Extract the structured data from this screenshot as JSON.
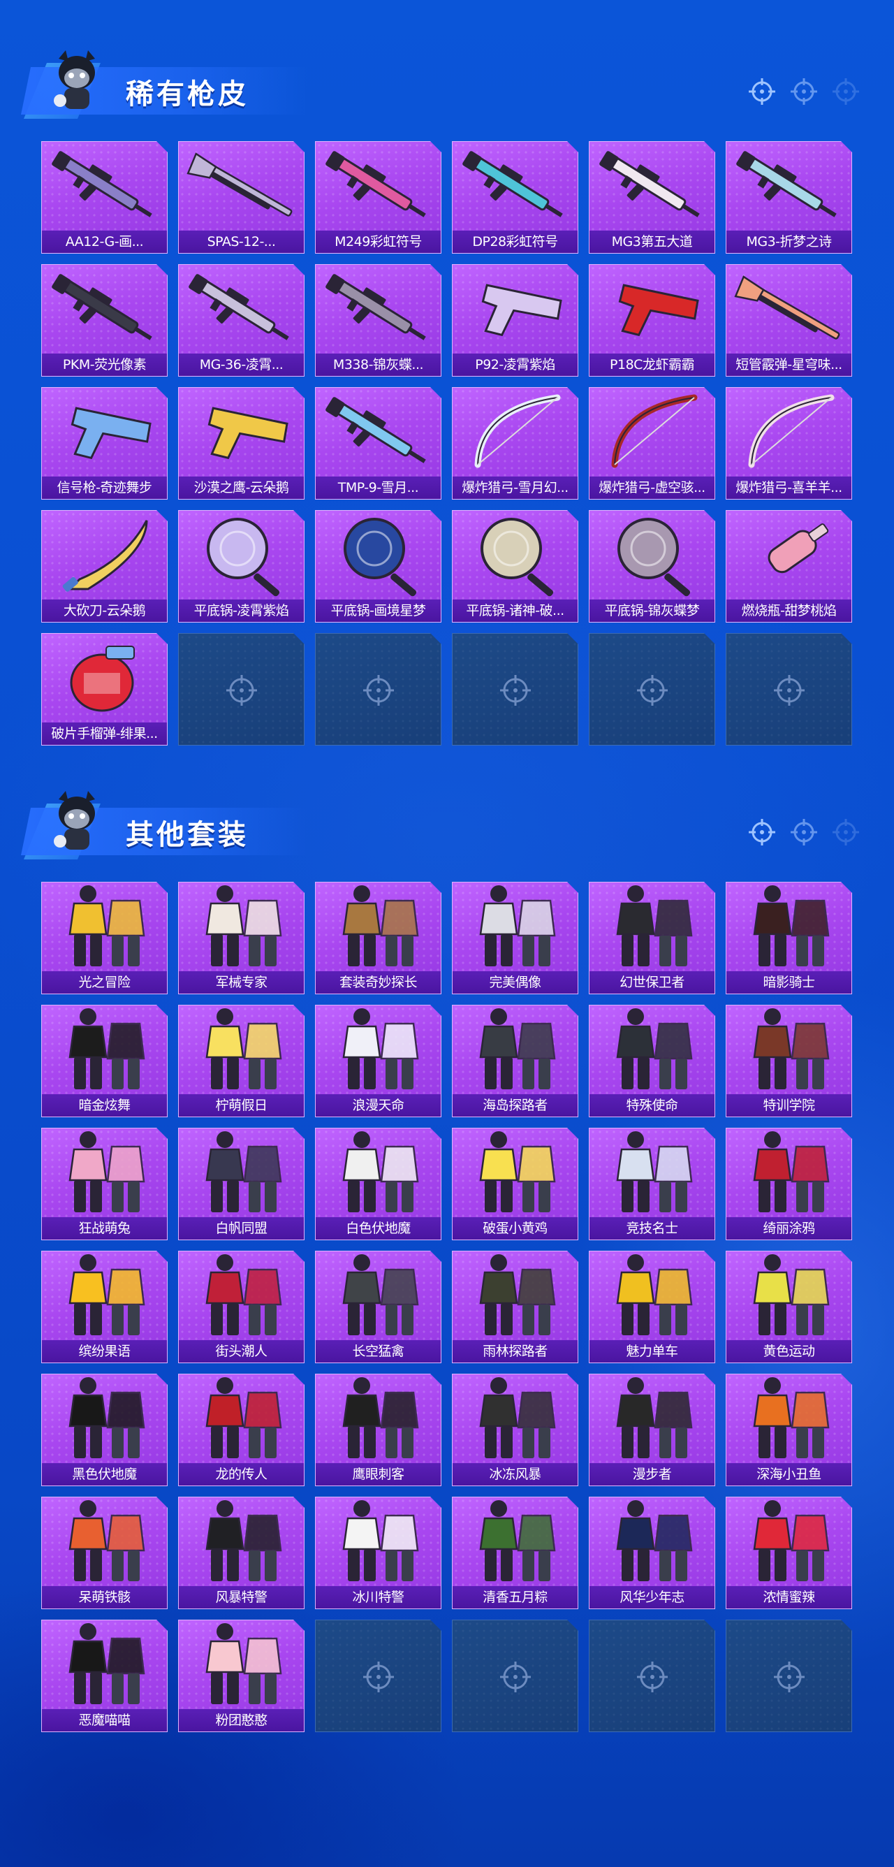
{
  "sections": {
    "skins": {
      "title": "稀有枪皮",
      "items": [
        {
          "label": "AA12-G-画...",
          "icon": "rifle-icon",
          "accent": "#8a7fc8"
        },
        {
          "label": "SPAS-12-...",
          "icon": "shotgun-icon",
          "accent": "#c0b6d8"
        },
        {
          "label": "M249彩虹符号",
          "icon": "machine-gun-icon",
          "accent": "#e05aa0"
        },
        {
          "label": "DP28彩虹符号",
          "icon": "machine-gun-icon",
          "accent": "#4fc4d8"
        },
        {
          "label": "MG3第五大道",
          "icon": "machine-gun-icon",
          "accent": "#f0e8f0"
        },
        {
          "label": "MG3-折梦之诗",
          "icon": "machine-gun-icon",
          "accent": "#a8d8e8"
        },
        {
          "label": "PKM-荧光像素",
          "icon": "machine-gun-icon",
          "accent": "#3a3a48"
        },
        {
          "label": "MG-36-凌霄...",
          "icon": "rifle-icon",
          "accent": "#c8c0dc"
        },
        {
          "label": "M338-锦灰蝶...",
          "icon": "rifle-icon",
          "accent": "#9a90a8"
        },
        {
          "label": "P92-凌霄紫焰",
          "icon": "pistol-icon",
          "accent": "#d8c8f0"
        },
        {
          "label": "P18C龙虾霸霸",
          "icon": "pistol-icon",
          "accent": "#d82828"
        },
        {
          "label": "短管霰弹-星穹味...",
          "icon": "shotgun-icon",
          "accent": "#f0a080"
        },
        {
          "label": "信号枪-奇迹舞步",
          "icon": "flare-gun-icon",
          "accent": "#7ab0f0"
        },
        {
          "label": "沙漠之鹰-云朵鹅",
          "icon": "pistol-icon",
          "accent": "#f0c848"
        },
        {
          "label": "TMP-9-雪月...",
          "icon": "smg-icon",
          "accent": "#80c8f0"
        },
        {
          "label": "爆炸猎弓-雪月幻...",
          "icon": "bow-icon",
          "accent": "#e8f0f8"
        },
        {
          "label": "爆炸猎弓-虚空骇...",
          "icon": "bow-icon",
          "accent": "#a82828"
        },
        {
          "label": "爆炸猎弓-喜羊羊...",
          "icon": "bow-icon",
          "accent": "#f0e0e8"
        },
        {
          "label": "大砍刀-云朵鹅",
          "icon": "machete-icon",
          "accent": "#f0d060"
        },
        {
          "label": "平底锅-凌霄紫焰",
          "icon": "frying-pan-icon",
          "accent": "#c8b8f0"
        },
        {
          "label": "平底锅-画境星梦",
          "icon": "frying-pan-icon",
          "accent": "#2848a0"
        },
        {
          "label": "平底锅-诸神-破...",
          "icon": "frying-pan-icon",
          "accent": "#d8d0b8"
        },
        {
          "label": "平底锅-锦灰蝶梦",
          "icon": "frying-pan-icon",
          "accent": "#a898b0"
        },
        {
          "label": "燃烧瓶-甜梦桃焰",
          "icon": "molotov-icon",
          "accent": "#f0a0b8"
        },
        {
          "label": "破片手榴弹-绯果...",
          "icon": "grenade-icon",
          "accent": "#e02838"
        }
      ],
      "empty_slots": 5
    },
    "suits": {
      "title": "其他套装",
      "items": [
        {
          "label": "光之冒险",
          "icon": "outfit-icon",
          "accent": "#f0c030"
        },
        {
          "label": "军械专家",
          "icon": "outfit-icon",
          "accent": "#f0e8e0"
        },
        {
          "label": "套装奇妙探长",
          "icon": "outfit-icon",
          "accent": "#a87840"
        },
        {
          "label": "完美偶像",
          "icon": "outfit-icon",
          "accent": "#dcdce4"
        },
        {
          "label": "幻世保卫者",
          "icon": "outfit-icon",
          "accent": "#2a2a30"
        },
        {
          "label": "暗影骑士",
          "icon": "outfit-icon",
          "accent": "#3a2020"
        },
        {
          "label": "暗金炫舞",
          "icon": "outfit-icon",
          "accent": "#1c1c1c"
        },
        {
          "label": "柠萌假日",
          "icon": "outfit-icon",
          "accent": "#f8e060"
        },
        {
          "label": "浪漫天命",
          "icon": "outfit-icon",
          "accent": "#f0f0f8"
        },
        {
          "label": "海岛探路者",
          "icon": "outfit-icon",
          "accent": "#383c44"
        },
        {
          "label": "特殊使命",
          "icon": "outfit-icon",
          "accent": "#2c3038"
        },
        {
          "label": "特训学院",
          "icon": "outfit-icon",
          "accent": "#7a3828"
        },
        {
          "label": "狂战萌兔",
          "icon": "outfit-icon",
          "accent": "#f0a8c8"
        },
        {
          "label": "白帆同盟",
          "icon": "outfit-icon",
          "accent": "#383850"
        },
        {
          "label": "白色伏地魔",
          "icon": "outfit-icon",
          "accent": "#f0f0f0"
        },
        {
          "label": "破蛋小黄鸡",
          "icon": "outfit-icon",
          "accent": "#f8e050"
        },
        {
          "label": "竞技名士",
          "icon": "outfit-icon",
          "accent": "#d8e0f0"
        },
        {
          "label": "绮丽涂鸦",
          "icon": "outfit-icon",
          "accent": "#c02030"
        },
        {
          "label": "缤纷果语",
          "icon": "outfit-icon",
          "accent": "#f8c020"
        },
        {
          "label": "街头潮人",
          "icon": "outfit-icon",
          "accent": "#c02038"
        },
        {
          "label": "长空猛禽",
          "icon": "outfit-icon",
          "accent": "#404448"
        },
        {
          "label": "雨林探路者",
          "icon": "outfit-icon",
          "accent": "#3c4030"
        },
        {
          "label": "魅力单车",
          "icon": "outfit-icon",
          "accent": "#f0c020"
        },
        {
          "label": "黄色运动",
          "icon": "outfit-icon",
          "accent": "#e8e048"
        },
        {
          "label": "黑色伏地魔",
          "icon": "outfit-icon",
          "accent": "#181818"
        },
        {
          "label": "龙的传人",
          "icon": "outfit-icon",
          "accent": "#c02028"
        },
        {
          "label": "鹰眼刺客",
          "icon": "outfit-icon",
          "accent": "#202020"
        },
        {
          "label": "冰冻风暴",
          "icon": "outfit-icon",
          "accent": "#303030"
        },
        {
          "label": "漫步者",
          "icon": "outfit-icon",
          "accent": "#282828"
        },
        {
          "label": "深海小丑鱼",
          "icon": "outfit-icon",
          "accent": "#e87020"
        },
        {
          "label": "呆萌铁骸",
          "icon": "outfit-icon",
          "accent": "#e86030"
        },
        {
          "label": "风暴特警",
          "icon": "outfit-icon",
          "accent": "#202024"
        },
        {
          "label": "冰川特警",
          "icon": "outfit-icon",
          "accent": "#f4f4f4"
        },
        {
          "label": "清香五月粽",
          "icon": "outfit-icon",
          "accent": "#3c7030"
        },
        {
          "label": "风华少年志",
          "icon": "outfit-icon",
          "accent": "#1c2858"
        },
        {
          "label": "浓情蜜辣",
          "icon": "outfit-icon",
          "accent": "#e02838"
        },
        {
          "label": "恶魔喵喵",
          "icon": "outfit-icon",
          "accent": "#181818"
        },
        {
          "label": "粉团憨憨",
          "icon": "outfit-icon",
          "accent": "#f8c8d0"
        }
      ],
      "empty_slots": 4
    }
  }
}
